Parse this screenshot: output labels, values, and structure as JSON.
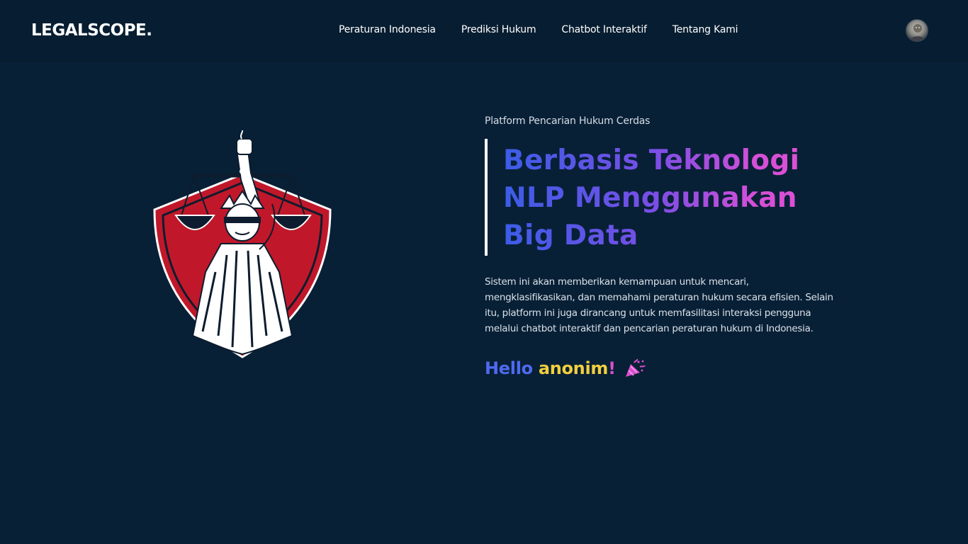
{
  "navbar": {
    "brand": "LEGALSCOPE.",
    "links": [
      {
        "label": "Peraturan Indonesia"
      },
      {
        "label": "Prediksi Hukum"
      },
      {
        "label": "Chatbot Interaktif"
      },
      {
        "label": "Tentang Kami"
      }
    ],
    "avatar_icon": "user-avatar-icon"
  },
  "hero": {
    "logo_icon": "lady-justice-shield-icon",
    "eyebrow": "Platform Pencarian Hukum Cerdas",
    "headline": {
      "line1": "Berbasis Teknologi",
      "line2": "NLP Menggunakan",
      "line3": "Big Data"
    },
    "description": "Sistem ini akan memberikan kemampuan untuk mencari, mengklasifikasikan, dan memahami peraturan hukum secara efisien. Selain itu, platform ini juga dirancang untuk memfasilitasi interaksi pengguna melalui chatbot interaktif dan pencarian peraturan hukum di Indonesia.",
    "greeting": {
      "hello": "Hello",
      "name": "anonim",
      "bang": "!",
      "icon": "party-popper-icon"
    }
  },
  "colors": {
    "background": "#082036",
    "navbar": "#071d31",
    "gradient_start": "#3b5de7",
    "gradient_end": "#e450d2",
    "greeting_name": "#f2cf3e",
    "shield_red": "#c0182a"
  }
}
